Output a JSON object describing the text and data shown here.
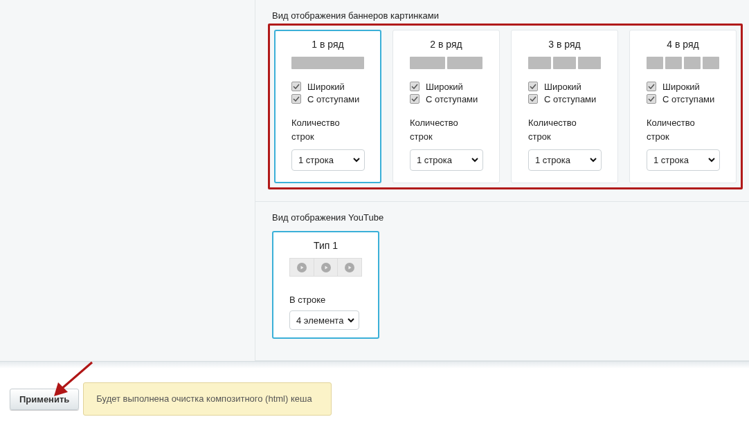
{
  "banner_section": {
    "title": "Вид отображения баннеров картинками",
    "highlighted": true,
    "cards": [
      {
        "title": "1 в ряд",
        "selected": true,
        "options": [
          {
            "label": "Широкий",
            "checked": true
          },
          {
            "label": "С отступами",
            "checked": true
          }
        ],
        "rows_label": "Количество строк",
        "rows_value": "1 строка"
      },
      {
        "title": "2 в ряд",
        "selected": false,
        "options": [
          {
            "label": "Широкий",
            "checked": true
          },
          {
            "label": "С отступами",
            "checked": true
          }
        ],
        "rows_label": "Количество строк",
        "rows_value": "1 строка"
      },
      {
        "title": "3 в ряд",
        "selected": false,
        "options": [
          {
            "label": "Широкий",
            "checked": true
          },
          {
            "label": "С отступами",
            "checked": true
          }
        ],
        "rows_label": "Количество строк",
        "rows_value": "1 строка"
      },
      {
        "title": "4 в ряд",
        "selected": false,
        "options": [
          {
            "label": "Широкий",
            "checked": true
          },
          {
            "label": "С отступами",
            "checked": true
          }
        ],
        "rows_label": "Количество строк",
        "rows_value": "1 строка"
      }
    ]
  },
  "youtube_section": {
    "title": "Вид отображения YouTube",
    "cards": [
      {
        "title": "Тип 1",
        "selected": true,
        "count_label": "В строке",
        "count_value": "4 элемента"
      }
    ]
  },
  "footer": {
    "apply_button": "Применить",
    "note": "Будет выполнена очистка композитного (html) кеша",
    "arrow": true
  }
}
